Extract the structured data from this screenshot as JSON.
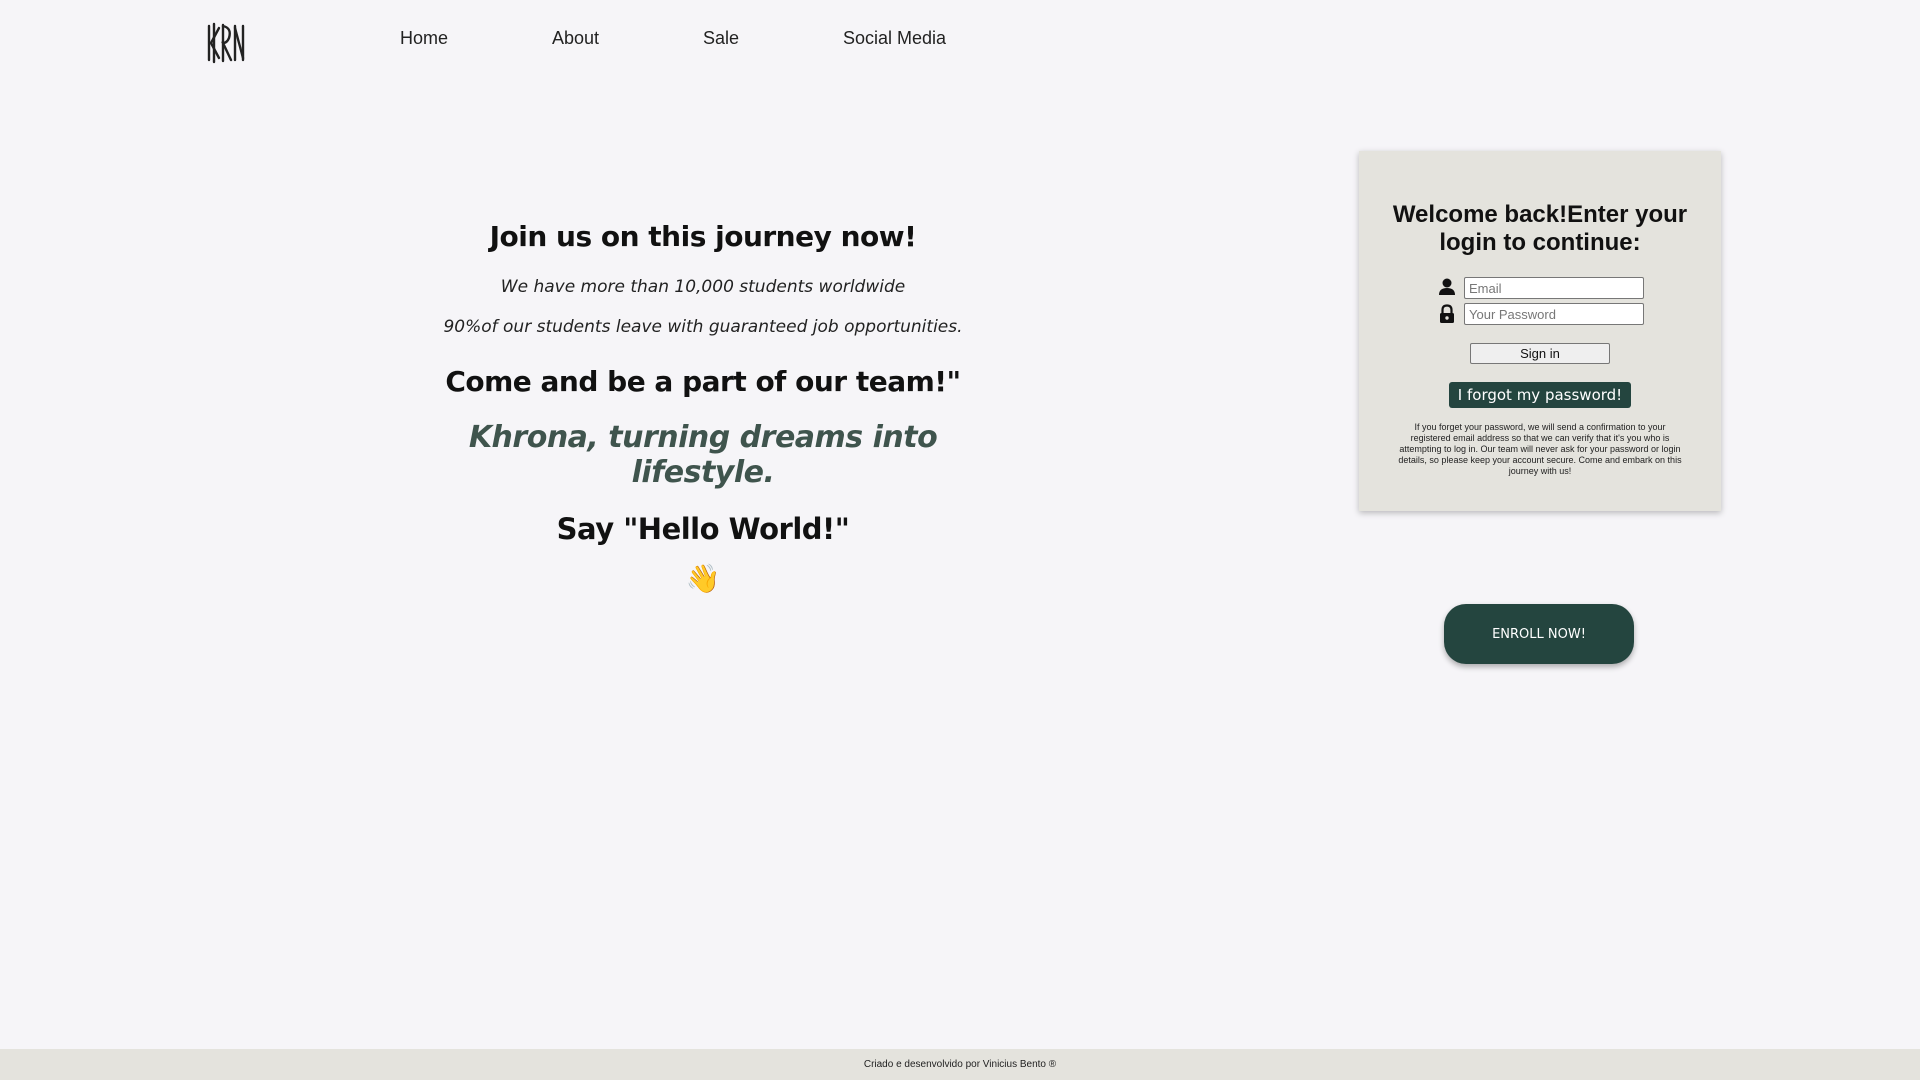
{
  "header": {
    "logo_text": "KRN",
    "nav": [
      "Home",
      "About",
      "Sale",
      "Social Media"
    ]
  },
  "hero": {
    "title": "Join us on this journey now!",
    "line1": "We have more than 10,000 students worldwide",
    "line2": "90%of our students leave with guaranteed job opportunities.",
    "subtitle": "Come and be a part of our team!\"",
    "slogan": "Khrona, turning dreams into lifestyle.",
    "hello": "Say \"Hello World!\"",
    "emoji": "👋"
  },
  "login": {
    "title": "Welcome back!Enter your login to continue:",
    "email_placeholder": "Email",
    "password_placeholder": "Your Password",
    "signin_label": "Sign in",
    "forgot_label": "I forgot my password!",
    "note": "If you forget your password, we will send a confirmation to your registered email address so that we can verify that it's you who is attempting to log in. Our team will never ask for your password or login details, so please keep your account secure. Come and embark on this journey with us!"
  },
  "enroll_label": "ENROLL NOW!",
  "footer": "Criado e desenvolvido por Vinicius Bento ®",
  "colors": {
    "accent": "#24453f",
    "slogan": "#3f544d",
    "panel": "#e4e3dd",
    "background": "#f6f5f8"
  }
}
